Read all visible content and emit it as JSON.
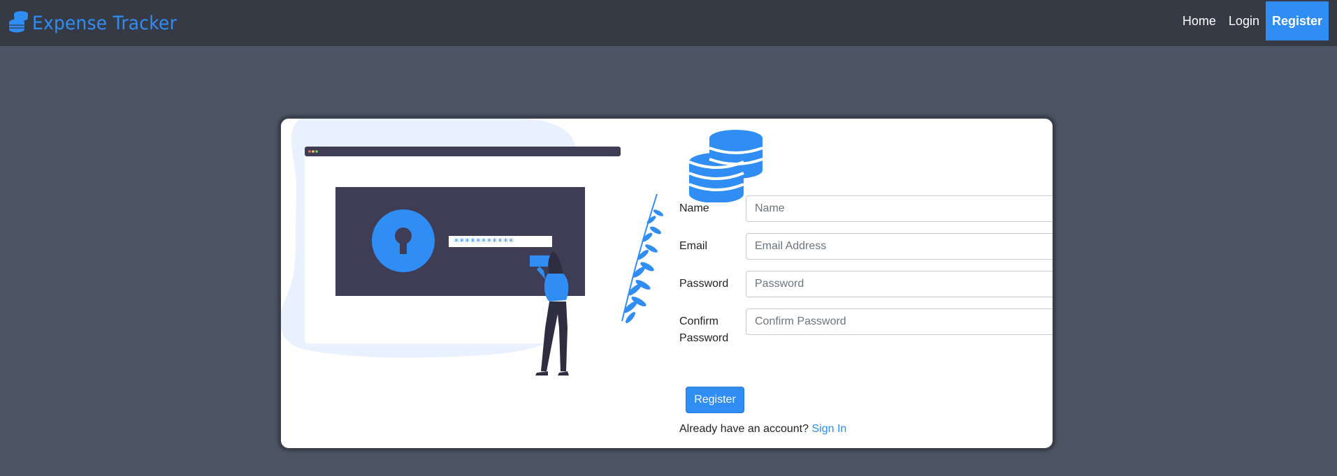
{
  "brand": {
    "name": "Expense Tracker",
    "icon": "coins-stack-icon",
    "color": "#2f8df3"
  },
  "nav": {
    "items": [
      {
        "label": "Home"
      },
      {
        "label": "Login"
      },
      {
        "label": "Register"
      }
    ],
    "active": "Register"
  },
  "illustration": {
    "password_mask": "***********"
  },
  "form": {
    "name": {
      "label": "Name",
      "placeholder": "Name"
    },
    "email": {
      "label": "Email",
      "placeholder": "Email Address"
    },
    "password": {
      "label": "Password",
      "placeholder": "Password"
    },
    "confirm": {
      "label_line1": "Confirm",
      "label_line2": "Password",
      "placeholder": "Confirm Password"
    },
    "submit_label": "Register",
    "signin_prompt": "Already have an account?",
    "signin_link": "Sign In"
  },
  "colors": {
    "accent": "#2f8df3",
    "navbar": "#363a44",
    "page_bg": "#4d5464"
  }
}
